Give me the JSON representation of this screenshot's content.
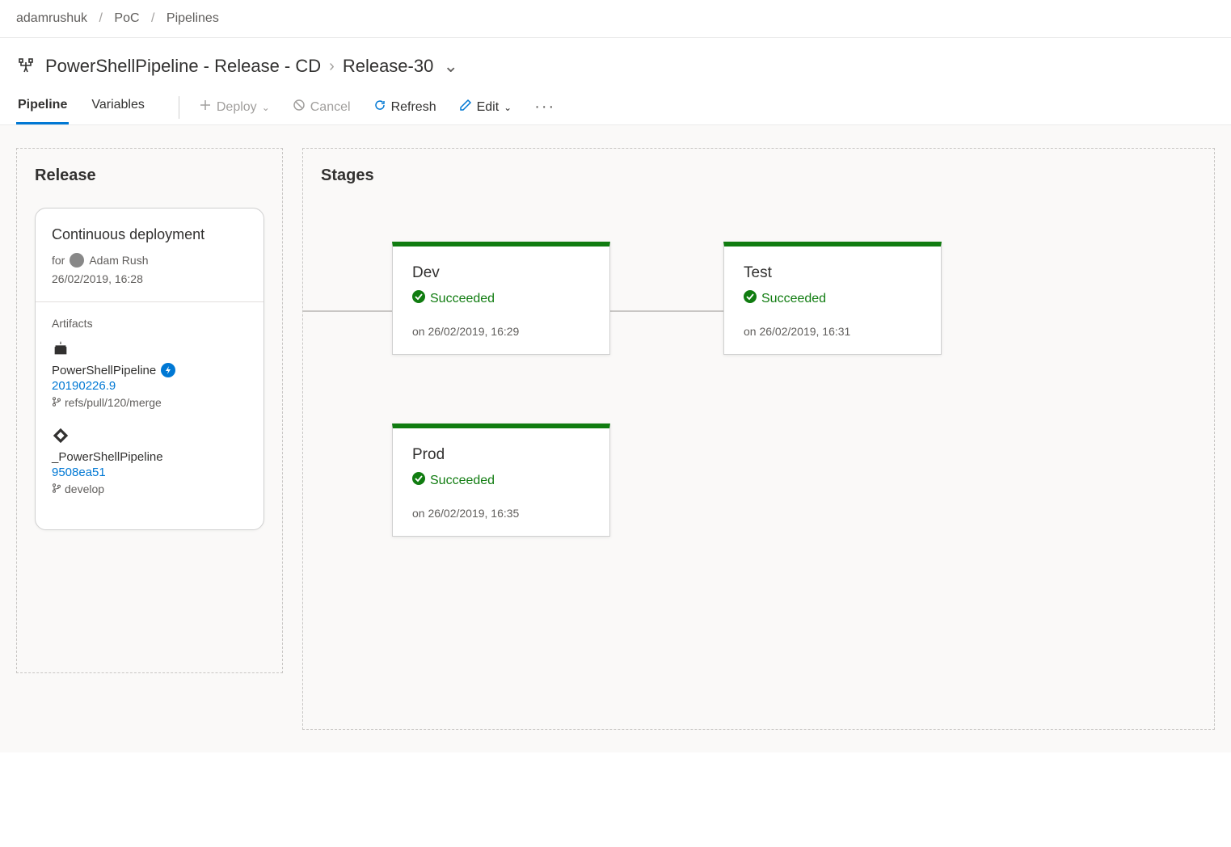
{
  "breadcrumb": {
    "items": [
      "adamrushuk",
      "PoC",
      "Pipelines"
    ]
  },
  "header": {
    "pipeline_title": "PowerShellPipeline - Release - CD",
    "release_name": "Release-30"
  },
  "tabs": {
    "pipeline": "Pipeline",
    "variables": "Variables"
  },
  "toolbar": {
    "deploy": "Deploy",
    "cancel": "Cancel",
    "refresh": "Refresh",
    "edit": "Edit"
  },
  "panels": {
    "release_title": "Release",
    "stages_title": "Stages"
  },
  "release": {
    "trigger": "Continuous deployment",
    "for_prefix": "for",
    "user": "Adam Rush",
    "created": "26/02/2019, 16:28",
    "artifacts_heading": "Artifacts",
    "artifacts": [
      {
        "name": "PowerShellPipeline",
        "version": "20190226.9",
        "branch": "refs/pull/120/merge",
        "trigger_badge": true,
        "type": "build"
      },
      {
        "name": "_PowerShellPipeline",
        "version": "9508ea51",
        "branch": "develop",
        "trigger_badge": false,
        "type": "repo"
      }
    ]
  },
  "stages": [
    {
      "name": "Dev",
      "status": "Succeeded",
      "time": "on 26/02/2019, 16:29"
    },
    {
      "name": "Test",
      "status": "Succeeded",
      "time": "on 26/02/2019, 16:31"
    },
    {
      "name": "Prod",
      "status": "Succeeded",
      "time": "on 26/02/2019, 16:35"
    }
  ],
  "status_color": "#107c10"
}
